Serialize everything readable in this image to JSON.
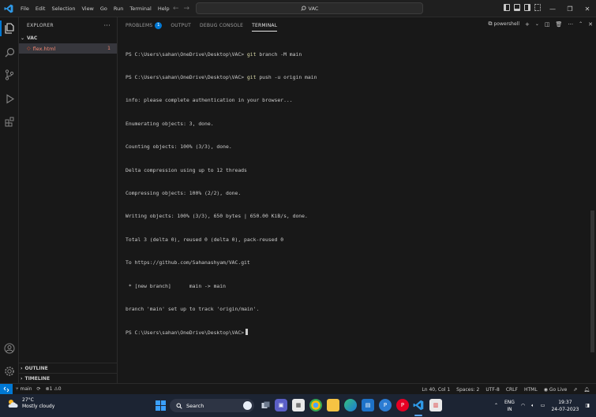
{
  "menu": {
    "items": [
      "File",
      "Edit",
      "Selection",
      "View",
      "Go",
      "Run",
      "Terminal",
      "Help"
    ]
  },
  "command_center": {
    "label": "VAC"
  },
  "sidebar": {
    "title": "EXPLORER",
    "folder": "VAC",
    "file": {
      "name": "flex.html",
      "problems": "1"
    },
    "sections": [
      "OUTLINE",
      "TIMELINE"
    ]
  },
  "panel": {
    "tabs": [
      {
        "label": "PROBLEMS",
        "badge": "1"
      },
      {
        "label": "OUTPUT"
      },
      {
        "label": "DEBUG CONSOLE"
      },
      {
        "label": "TERMINAL",
        "active": true
      }
    ],
    "shell": "powershell"
  },
  "terminal": {
    "prompt": "PS C:\\Users\\sahan\\OneDrive\\Desktop\\VAC>",
    "lines": [
      {
        "prompt": "PS C:\\Users\\sahan\\OneDrive\\Desktop\\VAC>",
        "cmd": "git",
        "args": "branch -M main"
      },
      {
        "prompt": "PS C:\\Users\\sahan\\OneDrive\\Desktop\\VAC>",
        "cmd": "git",
        "args": "push -u origin main"
      },
      {
        "text": "info: please complete authentication in your browser..."
      },
      {
        "text": "Enumerating objects: 3, done."
      },
      {
        "text": "Counting objects: 100% (3/3), done."
      },
      {
        "text": "Delta compression using up to 12 threads"
      },
      {
        "text": "Compressing objects: 100% (2/2), done."
      },
      {
        "text": "Writing objects: 100% (3/3), 650 bytes | 650.00 KiB/s, done."
      },
      {
        "text": "Total 3 (delta 0), reused 0 (delta 0), pack-reused 0"
      },
      {
        "text": "To https://github.com/Sahanashyam/VAC.git"
      },
      {
        "text": " * [new branch]      main -> main"
      },
      {
        "text": "branch 'main' set up to track 'origin/main'."
      }
    ]
  },
  "statusbar": {
    "branch": "main",
    "errors": "1",
    "warnings": "0",
    "position": "Ln 40, Col 1",
    "spaces": "Spaces: 2",
    "encoding": "UTF-8",
    "eol": "CRLF",
    "language": "HTML",
    "golive": "Go Live"
  },
  "taskbar": {
    "weather_temp": "27°C",
    "weather_desc": "Mostly cloudy",
    "search_label": "Search",
    "lang_top": "ENG",
    "lang_bottom": "IN",
    "time": "19:37",
    "date": "24-07-2023"
  },
  "colors": {
    "accent": "#0078d4",
    "error_file": "#f48771",
    "git_cmd": "#dcdcaa",
    "background": "#181818"
  }
}
